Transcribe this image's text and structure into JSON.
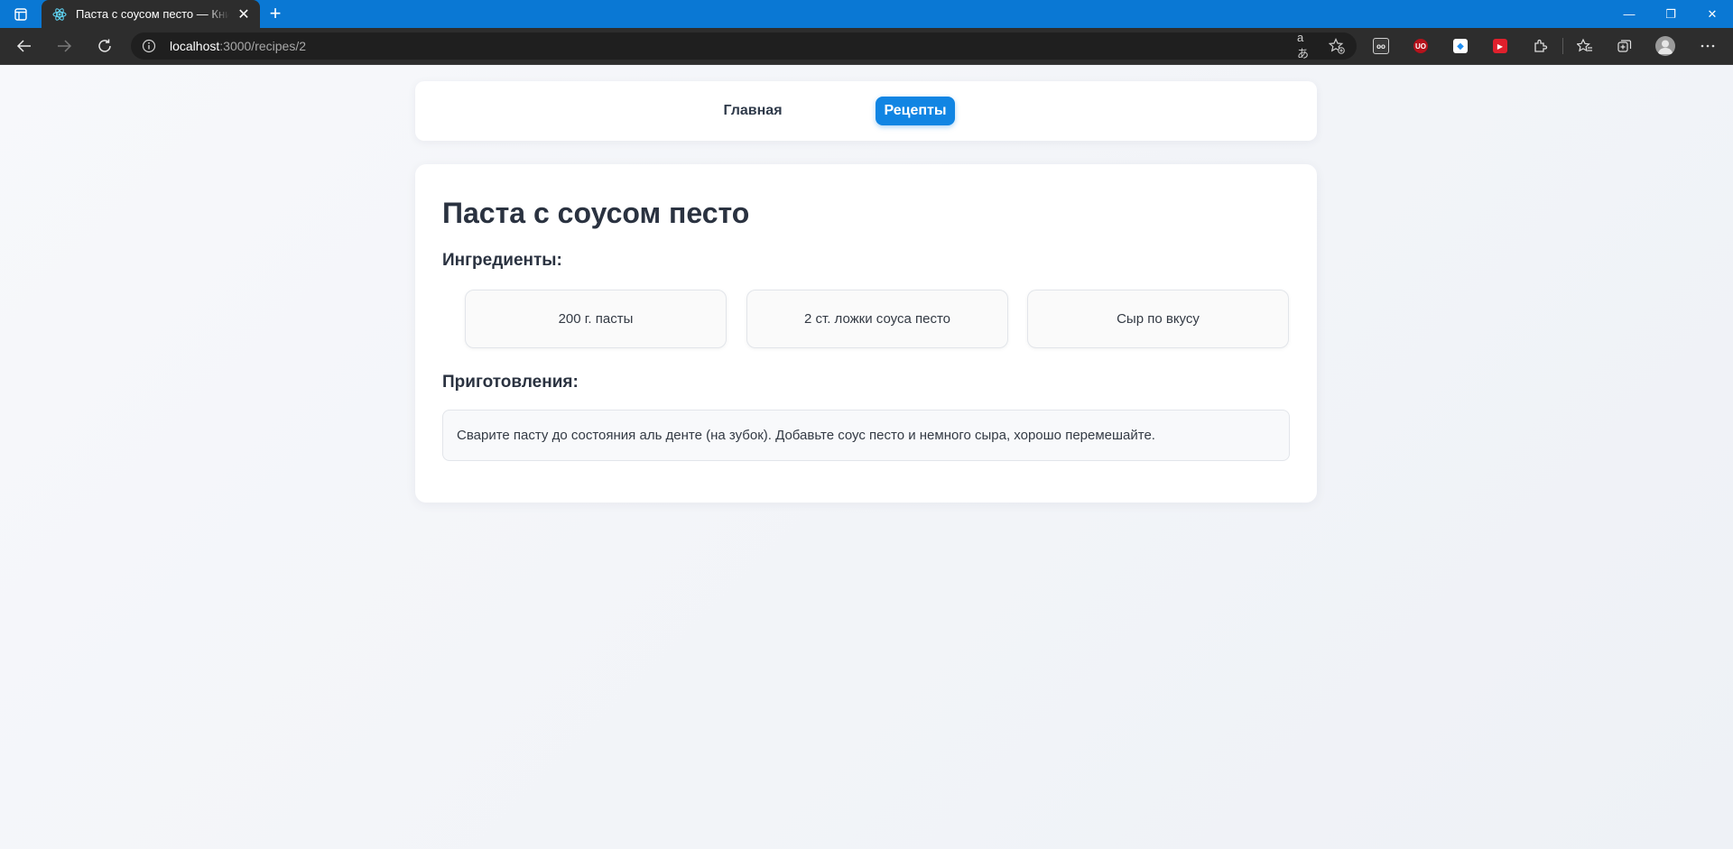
{
  "browser": {
    "tab_title": "Паста с соусом песто — Книга рецептов",
    "url_host": "localhost",
    "url_rest": ":3000/recipes/2",
    "accent_color": "#0a78d4",
    "tab_close_glyph": "✕",
    "new_tab_glyph": "+",
    "window_controls": {
      "minimize": "—",
      "restore": "❐",
      "close": "✕"
    },
    "read_aloud_glyph": "aあ",
    "extensions": [
      {
        "name": "ext-reader-icon",
        "color": "#2d2d2d",
        "glyph": "oo"
      },
      {
        "name": "ext-ublock-icon",
        "color": "#b5121b",
        "glyph": "UO"
      },
      {
        "name": "ext-box-icon",
        "color": "#1f8ef1",
        "glyph": "◆"
      },
      {
        "name": "ext-video-icon",
        "color": "#e0202c",
        "glyph": "▶"
      }
    ]
  },
  "nav": {
    "items": [
      {
        "label": "Главная",
        "active": false
      },
      {
        "label": "Рецепты",
        "active": true
      }
    ],
    "active_color": "#1185e3"
  },
  "recipe": {
    "title": "Паста с соусом песто",
    "ingredients_heading": "Ингредиенты:",
    "ingredients": [
      "200 г. пасты",
      "2 ст. ложки соуса песто",
      "Сыр по вкусу"
    ],
    "instructions_heading": "Приготовления:",
    "instructions": "Сварите пасту до состояния аль денте (на зубок). Добавьте соус песто и немного сыра, хорошо перемешайте."
  }
}
